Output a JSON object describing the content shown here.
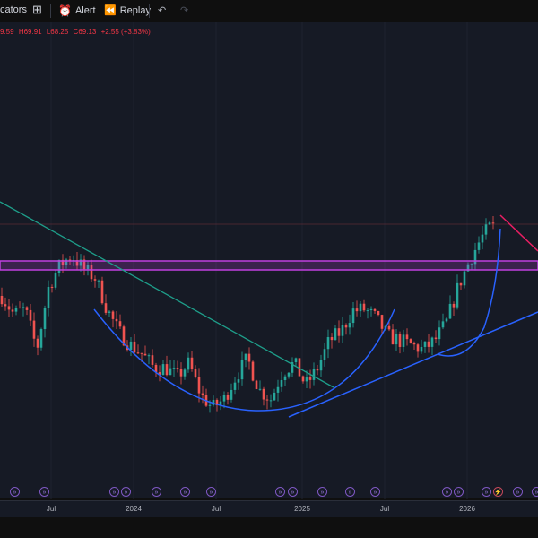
{
  "toolbar": {
    "indicators_label": "cators",
    "alert_label": "Alert",
    "replay_label": "Replay"
  },
  "legend": {
    "open": "9.59",
    "high": "H69.91",
    "low": "L68.25",
    "close": "C69.13",
    "change": "+2.55 (+3.83%)"
  },
  "time_axis": [
    "Jul",
    "2024",
    "Jul",
    "2025",
    "Jul",
    "2026"
  ],
  "colors": {
    "up": "#26a69a",
    "down": "#ef5350",
    "band": "#c040e0",
    "trend": "#2962ff",
    "teal": "#1e9e8a",
    "pink": "#e91e63"
  },
  "chart_data": {
    "type": "candlestick",
    "key_closes": [
      59.4,
      57.0,
      57.6,
      52.2,
      60.6,
      63.6,
      64.8,
      63.0,
      61.8,
      57.6,
      54.6,
      52.8,
      51.6,
      49.8,
      49.8,
      48.6,
      50.4,
      46.2,
      44.4,
      45.6,
      48.6,
      51.0,
      46.8,
      45.6,
      49.2,
      50.4,
      47.4,
      49.8,
      53.4,
      54.6,
      57.4,
      57.6,
      56.4,
      54.0,
      53.4,
      52.8,
      52.2,
      53.4,
      55.8,
      60.6,
      64.2,
      67.2,
      69.13
    ],
    "last_close": 69.13
  }
}
